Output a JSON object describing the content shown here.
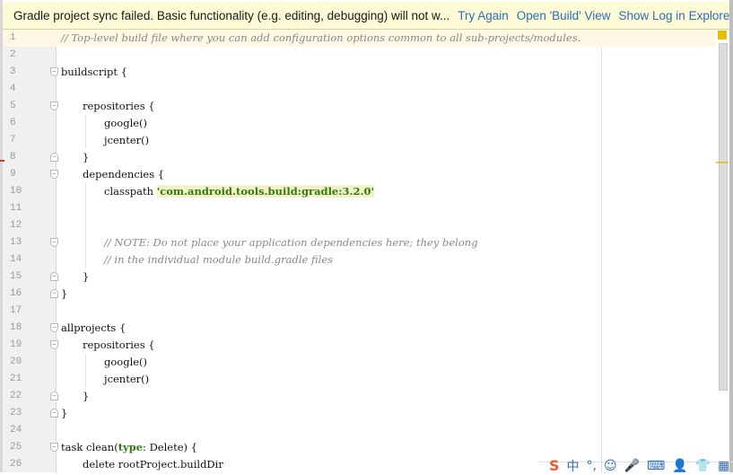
{
  "notification": {
    "message": "Gradle project sync failed. Basic functionality (e.g. editing, debugging) will not w...",
    "actions": [
      "Try Again",
      "Open 'Build' View",
      "Show Log in Explorer"
    ]
  },
  "editor": {
    "current_line": 1,
    "lines": [
      {
        "n": "1",
        "indent": 0,
        "type": "comment",
        "text": "// Top-level build file where you can add configuration options common to all sub-projects/modules."
      },
      {
        "n": "2",
        "indent": 0,
        "type": "code",
        "text": ""
      },
      {
        "n": "3",
        "indent": 0,
        "type": "code",
        "text": "buildscript {",
        "fold": "open"
      },
      {
        "n": "4",
        "indent": 0,
        "type": "code",
        "text": ""
      },
      {
        "n": "5",
        "indent": 1,
        "type": "code",
        "text": "repositories {",
        "fold": "open"
      },
      {
        "n": "6",
        "indent": 2,
        "type": "code",
        "text": "google()"
      },
      {
        "n": "7",
        "indent": 2,
        "type": "code",
        "text": "jcenter()"
      },
      {
        "n": "8",
        "indent": 1,
        "type": "code",
        "text": "}",
        "fold": "close"
      },
      {
        "n": "9",
        "indent": 1,
        "type": "code",
        "text": "dependencies {",
        "fold": "open"
      },
      {
        "n": "10",
        "indent": 2,
        "type": "string",
        "text": "classpath ",
        "str": "'com.android.tools.build:gradle:3.2.0'"
      },
      {
        "n": "11",
        "indent": 0,
        "type": "code",
        "text": ""
      },
      {
        "n": "12",
        "indent": 0,
        "type": "code",
        "text": ""
      },
      {
        "n": "13",
        "indent": 2,
        "type": "comment",
        "text": "// NOTE: Do not place your application dependencies here; they belong",
        "fold": "open"
      },
      {
        "n": "14",
        "indent": 2,
        "type": "comment",
        "text": "// in the individual module build.gradle files"
      },
      {
        "n": "15",
        "indent": 1,
        "type": "code",
        "text": "}",
        "fold": "close"
      },
      {
        "n": "16",
        "indent": 0,
        "type": "code",
        "text": "}",
        "fold": "close"
      },
      {
        "n": "17",
        "indent": 0,
        "type": "code",
        "text": ""
      },
      {
        "n": "18",
        "indent": 0,
        "type": "code",
        "text": "allprojects {",
        "fold": "open"
      },
      {
        "n": "19",
        "indent": 1,
        "type": "code",
        "text": "repositories {",
        "fold": "open"
      },
      {
        "n": "20",
        "indent": 2,
        "type": "code",
        "text": "google()"
      },
      {
        "n": "21",
        "indent": 2,
        "type": "code",
        "text": "jcenter()"
      },
      {
        "n": "22",
        "indent": 1,
        "type": "code",
        "text": "}",
        "fold": "close"
      },
      {
        "n": "23",
        "indent": 0,
        "type": "code",
        "text": "}",
        "fold": "close"
      },
      {
        "n": "24",
        "indent": 0,
        "type": "code",
        "text": ""
      },
      {
        "n": "25",
        "indent": 0,
        "type": "keyword",
        "text": "task clean(",
        "kw": "type",
        "rest": ": Delete) {",
        "fold": "open"
      },
      {
        "n": "26",
        "indent": 1,
        "type": "code",
        "text": "delete rootProject.buildDir"
      }
    ]
  },
  "tray": {
    "icons": [
      "sogou-ime-icon",
      "chinese-mode-icon",
      "punctuation-icon",
      "emoji-icon",
      "voice-icon",
      "keyboard-icon",
      "user-icon",
      "skin-icon",
      "toolbox-icon"
    ],
    "glyphs": [
      "S",
      "中",
      "°,",
      "☺",
      "🎤",
      "⌨",
      "👤",
      "👕",
      "▦"
    ]
  },
  "colors": {
    "notification_bg": "#fdfad6",
    "link": "#2f6db5",
    "string": "#2e7d0e",
    "warning": "#e5bf00"
  }
}
